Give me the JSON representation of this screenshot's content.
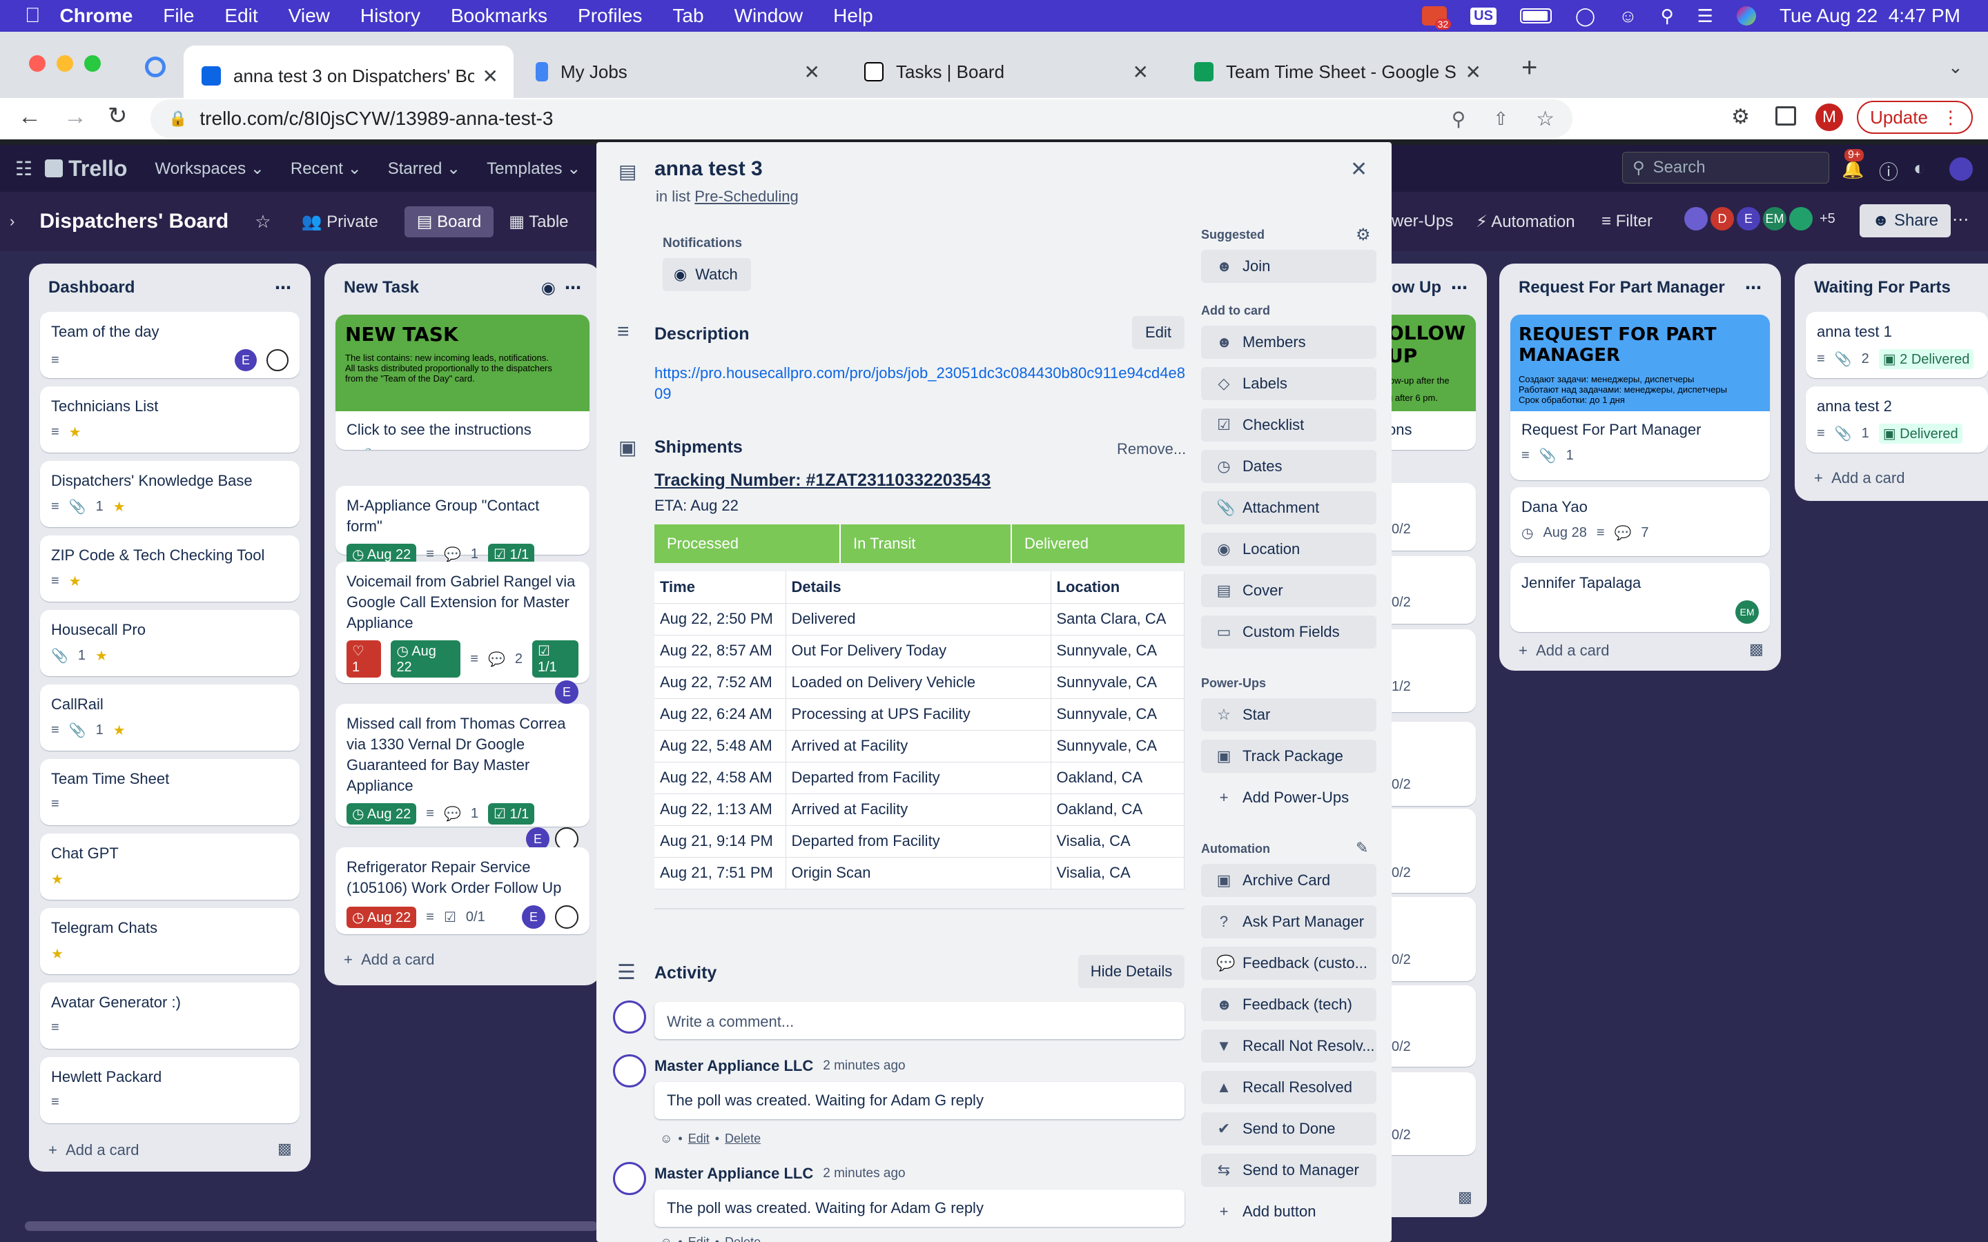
{
  "mac": {
    "app": "Chrome",
    "menu": [
      "File",
      "Edit",
      "View",
      "History",
      "Bookmarks",
      "Profiles",
      "Tab",
      "Window",
      "Help"
    ],
    "badge": "32",
    "input": "US",
    "datetime": "Tue Aug 22  4:47 PM"
  },
  "tabs": [
    {
      "title": "anna test 3 on Dispatchers' Bo",
      "active": true
    },
    {
      "title": "My Jobs"
    },
    {
      "title": "Tasks | Board"
    },
    {
      "title": "Team Time Sheet - Google She"
    }
  ],
  "address": {
    "url": "trello.com/c/8I0jsCYW/13989-anna-test-3",
    "update_label": "Update",
    "avatar": "M"
  },
  "trello": {
    "logo": "Trello",
    "nav": [
      "Workspaces",
      "Recent",
      "Starred",
      "Templates"
    ],
    "search_placeholder": "Search",
    "notif": "9+"
  },
  "boardbar": {
    "name": "Dispatchers' Board",
    "visibility": "Private",
    "view_board": "Board",
    "view_table": "Table",
    "powerups": "wer-Ups",
    "automation": "Automation",
    "filter": "Filter",
    "members_more": "+5",
    "share": "Share",
    "member_initials": [
      "D",
      "E",
      "EM"
    ]
  },
  "lists": [
    {
      "title": "Dashboard",
      "add": "Add a card",
      "cards": [
        {
          "title": "Team of the day",
          "avatar": "E"
        },
        {
          "title": "Technicians List"
        },
        {
          "title": "Dispatchers' Knowledge Base",
          "attach": "1"
        },
        {
          "title": "ZIP Code & Tech Checking Tool"
        },
        {
          "title": "Housecall Pro",
          "attach": "1"
        },
        {
          "title": "CallRail",
          "attach": "1"
        },
        {
          "title": "Team Time Sheet"
        },
        {
          "title": "Chat GPT"
        },
        {
          "title": "Telegram Chats"
        },
        {
          "title": "Avatar Generator :)"
        },
        {
          "title": "Hewlett Packard"
        }
      ]
    },
    {
      "title": "New Task",
      "add": "Add a card",
      "cover_title": "NEW TASK",
      "cover_line1": "The list contains: new incoming leads, notifications.",
      "cover_line2": "All tasks distributed proportionally to the dispatchers",
      "cover_line3": "from the \"Team of the Day\" card.",
      "cards": [
        {
          "title": "Click to see the instructions",
          "attach": "1"
        },
        {
          "title": "M-Appliance Group \"Contact form\"",
          "due": "Aug 22",
          "comments": "1",
          "check": "1/1"
        },
        {
          "title": "Voicemail from Gabriel Rangel via Google Call Extension for Master Appliance",
          "votes": "1",
          "due": "Aug 22",
          "comments": "2",
          "check": "1/1",
          "avatar": "E"
        },
        {
          "title": "Missed call from Thomas Correa via 1330 Vernal Dr Google Guaranteed for Bay Master Appliance",
          "due": "Aug 22",
          "comments": "1",
          "check": "1/1",
          "avatar": "E"
        },
        {
          "title": "Refrigerator Repair Service (105106) Work Order Follow Up",
          "due": "Aug 22",
          "check": "0/1",
          "avatar": "E"
        }
      ]
    },
    {
      "title": "ow Up",
      "cover_title": "OLLOW UP",
      "cover_sub": "low-up after the",
      "cover_sub2": "g after 6 pm.",
      "cards": [
        {
          "title": "ons"
        }
      ],
      "counts": [
        "0/2",
        "0/2",
        "1/2",
        "0/2",
        "0/2",
        "0/2",
        "0/2",
        "0/2"
      ]
    },
    {
      "title": "Request For Part Manager",
      "add": "Add a card",
      "cover_title": "REQUEST FOR PART MANAGER",
      "cover_line1": "Создают задачи: менеджеры, диспетчеры",
      "cover_line2": "Работают над задачами: менеджеры, диспетчеры",
      "cover_line3": "Срок обработки: до 1 дня",
      "cards": [
        {
          "title": "Request For Part Manager",
          "attach": "1"
        },
        {
          "title": "Dana Yao",
          "date": "Aug 28",
          "comments": "7"
        },
        {
          "title": "Jennifer Tapalaga",
          "avatar": "EM"
        }
      ]
    },
    {
      "title": "Waiting For Parts",
      "add": "Add a card",
      "cards": [
        {
          "title": "anna test 1",
          "attach": "2",
          "delivered": "2 Delivered"
        },
        {
          "title": "anna test 2",
          "attach": "1",
          "delivered": "Delivered"
        }
      ]
    }
  ],
  "modal": {
    "title": "anna test 3",
    "in_list_prefix": "in list",
    "in_list": "Pre-Scheduling",
    "notifications_label": "Notifications",
    "watch": "Watch",
    "description_heading": "Description",
    "edit": "Edit",
    "description_link": "https://pro.housecallpro.com/pro/jobs/job_23051dc3c084430b80c911e94cd4e809",
    "shipments_heading": "Shipments",
    "remove": "Remove...",
    "tracking": "Tracking Number: #1ZAT23110332203543",
    "eta": "ETA: Aug 22",
    "stages": [
      "Processed",
      "In Transit",
      "Delivered"
    ],
    "table_headers": [
      "Time",
      "Details",
      "Location"
    ],
    "rows": [
      [
        "Aug 22, 2:50 PM",
        "Delivered",
        "Santa Clara, CA"
      ],
      [
        "Aug 22, 8:57 AM",
        "Out For Delivery Today",
        "Sunnyvale, CA"
      ],
      [
        "Aug 22, 7:52 AM",
        "Loaded on Delivery Vehicle",
        "Sunnyvale, CA"
      ],
      [
        "Aug 22, 6:24 AM",
        "Processing at UPS Facility",
        "Sunnyvale, CA"
      ],
      [
        "Aug 22, 5:48 AM",
        "Arrived at Facility",
        "Sunnyvale, CA"
      ],
      [
        "Aug 22, 4:58 AM",
        "Departed from Facility",
        "Oakland, CA"
      ],
      [
        "Aug 22, 1:13 AM",
        "Arrived at Facility",
        "Oakland, CA"
      ],
      [
        "Aug 21, 9:14 PM",
        "Departed from Facility",
        "Visalia, CA"
      ],
      [
        "Aug 21, 7:51 PM",
        "Origin Scan",
        "Visalia, CA"
      ]
    ],
    "activity_heading": "Activity",
    "hide_details": "Hide Details",
    "comment_placeholder": "Write a comment...",
    "activities": [
      {
        "author": "Master Appliance LLC",
        "time": "2 minutes ago",
        "text": "The poll was created. Waiting for Adam G reply",
        "edit": "Edit",
        "delete": "Delete"
      },
      {
        "author": "Master Appliance LLC",
        "time": "2 minutes ago",
        "text": "The poll was created. Waiting for Adam G reply",
        "edit": "Edit",
        "delete": "Delete"
      }
    ],
    "sidebar": {
      "suggested": "Suggested",
      "join": "Join",
      "add_to_card": "Add to card",
      "add_items": [
        "Members",
        "Labels",
        "Checklist",
        "Dates",
        "Attachment",
        "Location",
        "Cover",
        "Custom Fields"
      ],
      "powerups_label": "Power-Ups",
      "powerups": [
        "Star",
        "Track Package"
      ],
      "add_powerups": "Add Power-Ups",
      "automation_label": "Automation",
      "automation": [
        "Archive Card",
        "Ask Part Manager",
        "Feedback (custo...",
        "Feedback (tech)",
        "Recall Not Resolv...",
        "Recall Resolved",
        "Send to Done",
        "Send to Manager"
      ],
      "add_button": "Add button"
    }
  },
  "colors": {
    "macbar": "#4437c9",
    "board_bg": "#2d2a52",
    "list_bg": "#e7e9ee",
    "green": "#7bc857",
    "due_green": "#1f845a",
    "due_red": "#c9372c",
    "avatar": "#4c3fba",
    "update_red": "#c5221f"
  }
}
